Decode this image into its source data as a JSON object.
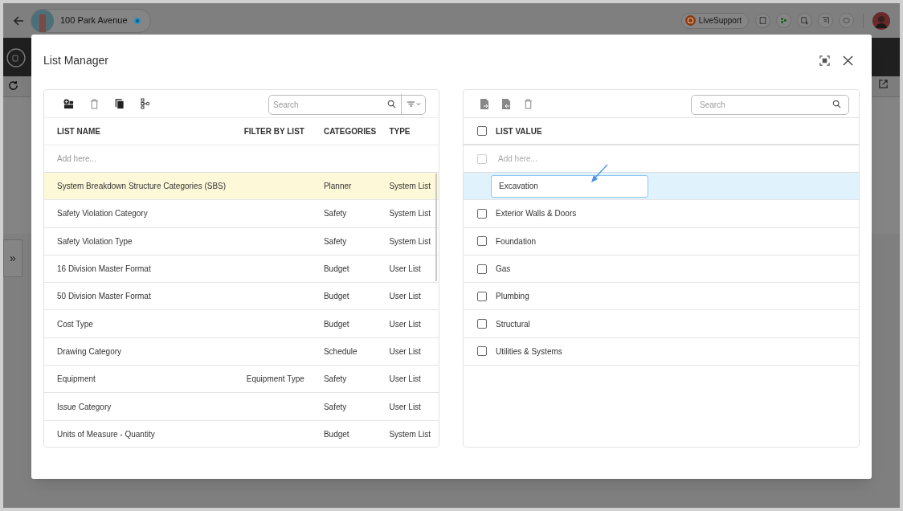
{
  "top_bar": {
    "project": "100 Park Avenue",
    "live_support": "LiveSupport"
  },
  "side_toggle": "»",
  "dialog": {
    "title": "List Manager",
    "lists_panel": {
      "search_placeholder": "Search",
      "columns": [
        "LIST NAME",
        "FILTER BY LIST",
        "CATEGORIES",
        "TYPE"
      ],
      "add_placeholder": "Add here...",
      "rows": [
        {
          "list_name": "System Breakdown Structure Categories (SBS)",
          "categories": "Planner",
          "type": "System List",
          "selected": true
        },
        {
          "list_name": "Safety Violation Category",
          "categories": "Safety",
          "type": "System List",
          "selected": false
        },
        {
          "list_name": "Safety Violation Type",
          "categories": "Safety",
          "type": "System List",
          "selected": false
        },
        {
          "list_name": "16 Division Master Format",
          "categories": "Budget",
          "type": "User List",
          "selected": false
        },
        {
          "list_name": "50 Division Master Format",
          "categories": "Budget",
          "type": "User List",
          "selected": false
        },
        {
          "list_name": "Cost Type",
          "categories": "Budget",
          "type": "User List",
          "selected": false
        },
        {
          "list_name": "Drawing Category",
          "categories": "Schedule",
          "type": "User List",
          "selected": false
        },
        {
          "list_name": "Equipment",
          "filter_by_list": "Equipment Type",
          "categories": "Safety",
          "type": "User List",
          "selected": false
        },
        {
          "list_name": "Issue Category",
          "categories": "Safety",
          "type": "User List",
          "selected": false
        },
        {
          "list_name": "Units of Measure - Quantity",
          "categories": "Budget",
          "type": "System List",
          "selected": false
        }
      ]
    },
    "values_panel": {
      "search_placeholder": "Search",
      "column": "LIST VALUE",
      "header_checked": false,
      "add_placeholder": "Add here...",
      "add_row_checked": false,
      "rows": [
        {
          "kind": "editing",
          "value": "Excavation"
        },
        {
          "kind": "item",
          "label": "Exterior Walls & Doors",
          "checked": false
        },
        {
          "kind": "item",
          "label": "Foundation",
          "checked": false
        },
        {
          "kind": "item",
          "label": "Gas",
          "checked": false
        },
        {
          "kind": "item",
          "label": "Plumbing",
          "checked": false
        },
        {
          "kind": "item",
          "label": "Structural",
          "checked": false
        },
        {
          "kind": "item",
          "label": "Utilities & Systems",
          "checked": false
        }
      ]
    }
  }
}
